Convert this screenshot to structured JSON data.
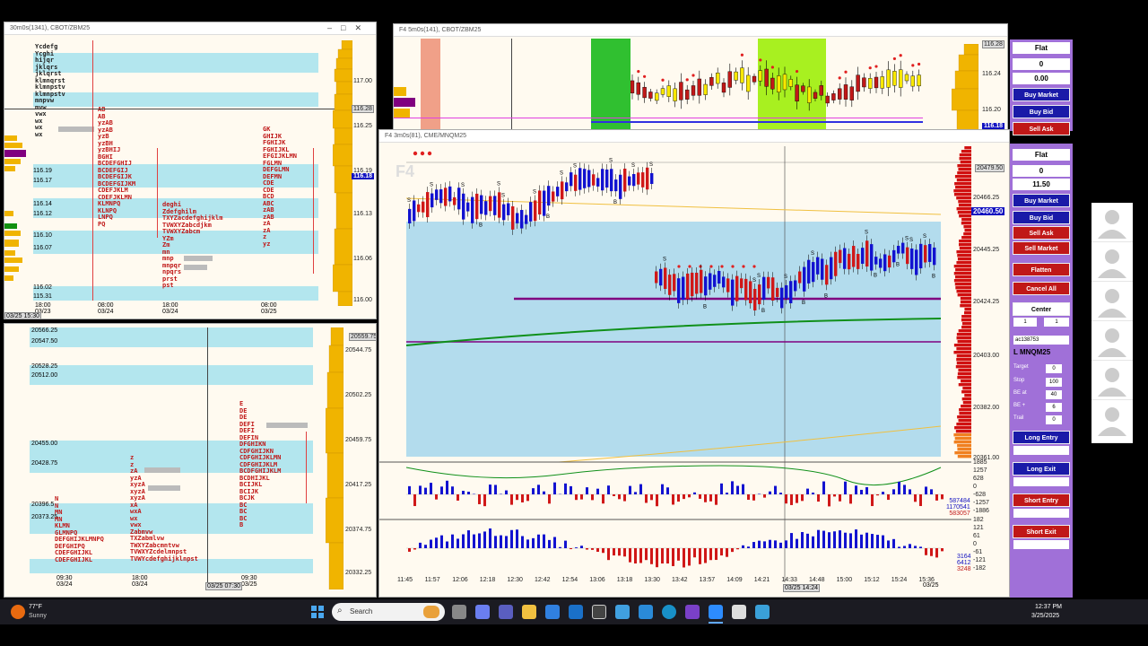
{
  "window_tl": {
    "title": "30m0s(1341), CBOT/ZBM25",
    "price_ticks": [
      "117.00",
      "116.25",
      "116.19",
      "116.13",
      "116.06",
      "116.00"
    ],
    "current_price": "116.18",
    "label_price": "116.28",
    "price_levels": [
      "116.19",
      "116.17",
      "116.14",
      "116.12",
      "116.10",
      "116.07",
      "116.02",
      "115.31"
    ],
    "time_labels": [
      {
        "t": "18:00",
        "d": "03/23"
      },
      {
        "t": "08:00",
        "d": "03/24"
      },
      {
        "t": "18:00",
        "d": "03/24"
      },
      {
        "t": "08:00",
        "d": "03/25"
      }
    ],
    "cursor_time": "03/25 15:30",
    "profile1": "Ycdefg\nYcghi\nhijqr\njklqrs\njklqrst\nklmnqrst\nklmnpstv\nklmnpstv\nmnpvw\nmvw\nvwx\nwx\nwx\nwx",
    "profile2": "AB\nAB\nyzAB\nyzAB\nyzB\nyzBH\nyzBHIJ\nBGHI\nBCDEFGHIJ\nBCDEFGIJ\nBCDEFGIJK\nBCDEFGIJKM\nCDEFJKLM\nCDEFJKLMN\nKLMNPQ\nKLNPQ\nLNPQ\nPQ",
    "profile3": "deghi\nZdefghilm\nTXYZacdefghijklm\nTVWXYZabcdjkm\nTVWXYZabcm\nYZm\nZm\nmn\nmnp\nmnpqr\nnpqrs\nprst\npst",
    "profile4": "GK\nGHIJK\nFGHIJK\nFGHIJKL\nEFGIJKLMN\nFGLMN\nDEFGLMN\nDEFMN\nCDE\nCDE\nBCD\nABC\nzAB\nzAB\nzA\nzA\nz\nyz"
  },
  "window_bl": {
    "price_ticks": [
      "20544.75",
      "20502.25",
      "20459.75",
      "20417.25",
      "20374.75",
      "20332.25"
    ],
    "current_price": "20559.75",
    "price_levels": [
      "20566.25",
      "20547.50",
      "20528.25",
      "20512.00",
      "20455.00",
      "20428.75",
      "20396.5",
      "20373.25"
    ],
    "time_labels": [
      {
        "t": "09:30",
        "d": "03/24"
      },
      {
        "t": "18:00",
        "d": "03/24"
      },
      {
        "t": "09:30",
        "d": "03/25"
      }
    ],
    "cursor_time": "03/25 07:30",
    "profile1": "N\nN\nMN\nMN\nKLMN\nGLMNPQ\nDEFGHIJKLMNPQ\nDEFGHIPQ\nCDEFGHIJKL\nCDEFGHIJKL",
    "profile2": "z\nz\nzA\nyzA\nxyzA\nxyzA\nxyzA\nxA\nwxA\nwx\nvwx\nZabmvw\nTXZabmlvw\nTWXYZabcmntvw\nTVWXYZcdelmnpst\nTVWYcdefghijklnpst",
    "profile3": "E\nDE\nDE\nDEFI\nDEFI\nDEFIN\nDFGHIKN\nCDFGHIJKN\nCDFGHIJKLMN\nCDFGHIJKLM\nBCDFGHIJKLM\nBCDHIJKL\nBCIJKL\nBCIJK\nBCJK\nBC\nBC\nBC\nB"
  },
  "window_top": {
    "title": "F4 5m0s(141), CBOT/ZBM25",
    "price_ticks": [
      "116.28",
      "116.24",
      "116.20",
      "116.18"
    ],
    "current_price": "116.18"
  },
  "window_main": {
    "title": "F4 3m0s(81), CME/MNQM25",
    "watermark": "F4",
    "price_ticks": [
      "20479.50",
      "20466.25",
      "20445.25",
      "20424.25",
      "20403.00",
      "20382.00",
      "20361.00"
    ],
    "current_price": "20460.50",
    "time_labels": [
      "11:45",
      "11:57",
      "12:06",
      "12:18",
      "12:30",
      "12:42",
      "12:54",
      "13:06",
      "13:18",
      "13:30",
      "13:42",
      "13:57",
      "14:09",
      "14:21",
      "14:33",
      "14:48",
      "15:00",
      "15:12",
      "15:24",
      "15:36"
    ],
    "last_date": "03/25",
    "cursor_time": "03/25 14:24",
    "sub1_ticks": [
      "1885",
      "1257",
      "628",
      "0",
      "-628",
      "-1257",
      "-1886"
    ],
    "sub1_values": [
      "587484",
      "1170541",
      "583057"
    ],
    "sub2_ticks": [
      "182",
      "121",
      "61",
      "0",
      "-61",
      "-121",
      "-182"
    ],
    "sub2_values": [
      "3164",
      "6412",
      "3248"
    ]
  },
  "dom_top": {
    "position": "Flat",
    "qty": "0",
    "pnl": "0.00",
    "buy_market": "Buy Market",
    "buy_bid": "Buy Bid",
    "sell_ask": "Sell Ask"
  },
  "dom_main": {
    "position": "Flat",
    "qty": "0",
    "pnl": "11.50",
    "buy_market": "Buy Market",
    "buy_bid": "Buy Bid",
    "sell_ask": "Sell Ask",
    "sell_market": "Sell Market",
    "flatten": "Flatten",
    "cancel_all": "Cancel All",
    "center": "Center",
    "qty1": "1",
    "qty2": "1",
    "account": "ac138753",
    "symbol": "L MNQM25",
    "target_label": "Target",
    "target_value": "0",
    "stop_label": "Stop",
    "stop_value": "100",
    "be_at_label": "BE at",
    "be_at_value": "40",
    "be_plus_label": "BE +",
    "be_plus_value": "6",
    "trail_label": "Trail",
    "trail_value": "0",
    "long_entry": "Long Entry",
    "long_exit": "Long Exit",
    "short_entry": "Short Entry",
    "short_exit": "Short Exit"
  },
  "taskbar": {
    "weather_temp": "77°F",
    "weather_desc": "Sunny",
    "search_placeholder": "Search",
    "time": "12:37 PM",
    "date": "3/25/2025"
  },
  "colors": {
    "bull": "#d01818",
    "bear": "#1212d0",
    "value_area": "#b3dced",
    "dom_bg": "#a070d8",
    "profile_orange": "#f0b400"
  }
}
